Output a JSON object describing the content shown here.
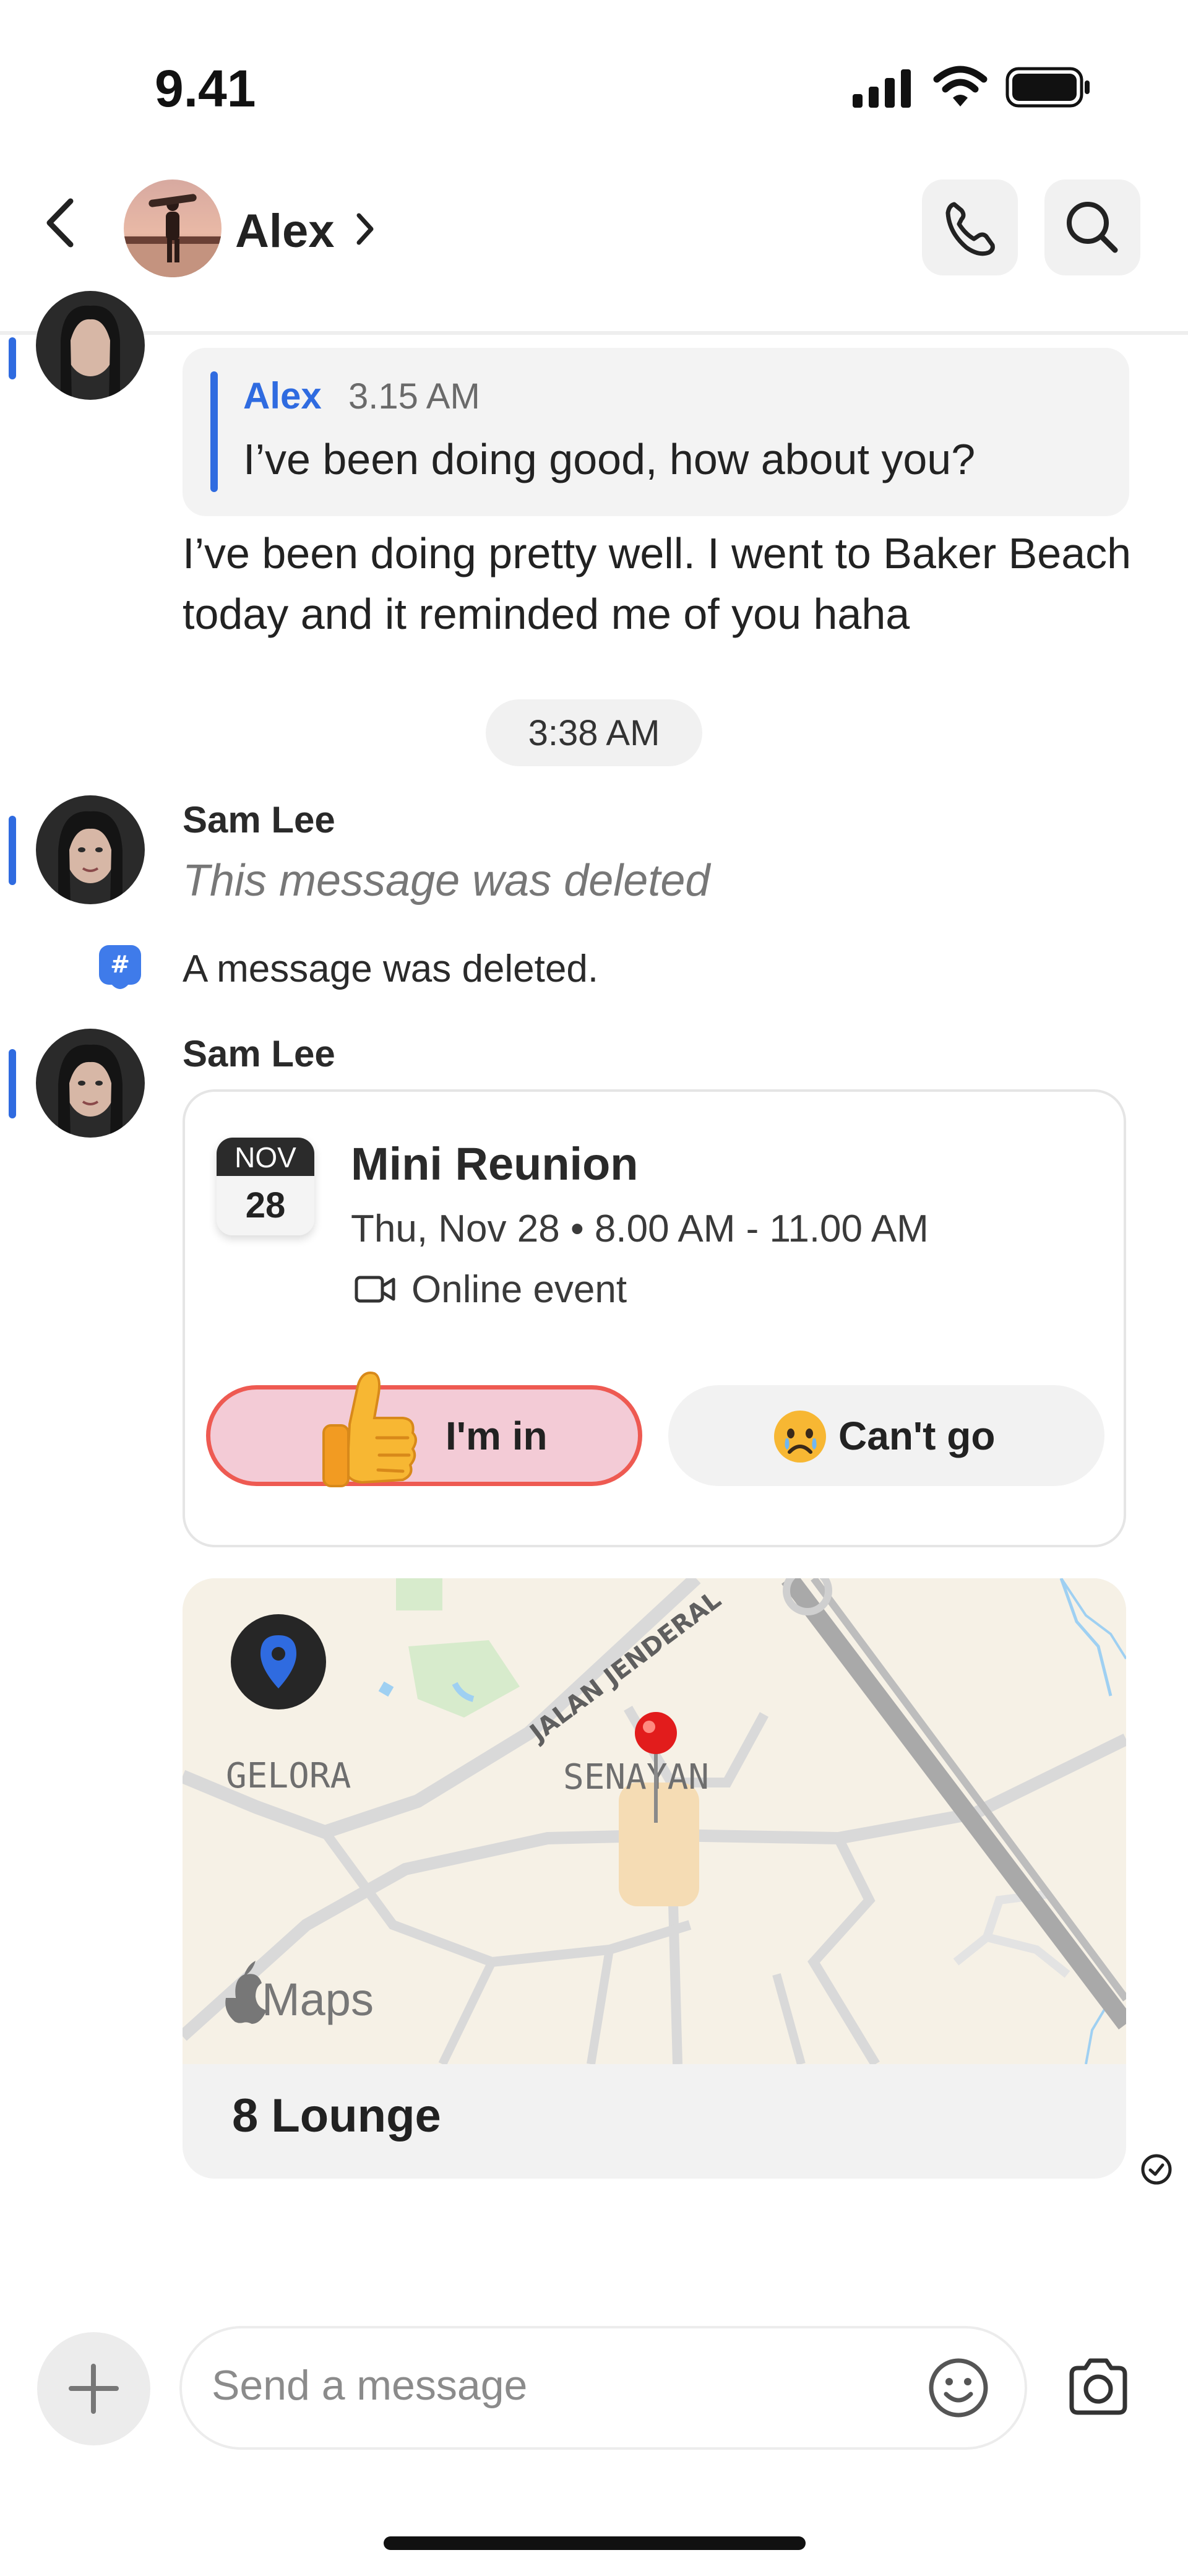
{
  "status_bar": {
    "time": "9.41"
  },
  "header": {
    "contact_name": "Alex"
  },
  "quoted": {
    "author": "Alex",
    "time": "3.15 AM",
    "text": "I’ve been doing good, how about you?"
  },
  "reply_text": "I’ve been doing pretty well. I went to Baker Beach today and it reminded me of you haha",
  "timestamp_divider": "3:38 AM",
  "deleted_message": {
    "sender": "Sam Lee",
    "text": "This message was deleted"
  },
  "system_notice": "A message was deleted.",
  "event_message": {
    "sender": "Sam Lee",
    "month": "NOV",
    "day": "28",
    "title": "Mini Reunion",
    "datetime": "Thu, Nov 28 • 8.00 AM - 11.00 AM",
    "type": "Online event",
    "rsvp_yes": "I'm in",
    "rsvp_no": "Can't go"
  },
  "location_message": {
    "map_labels": {
      "district_left": "GELORA",
      "district_center": "SENAYAN",
      "road": "JALAN JENDERAL",
      "maps_brand": "Maps"
    },
    "place_name": "8 Lounge"
  },
  "composer": {
    "placeholder": "Send a message"
  },
  "colors": {
    "accent_blue": "#2f6be0",
    "rsvp_border": "#ee5a52",
    "rsvp_fill": "#f3cbd6"
  }
}
